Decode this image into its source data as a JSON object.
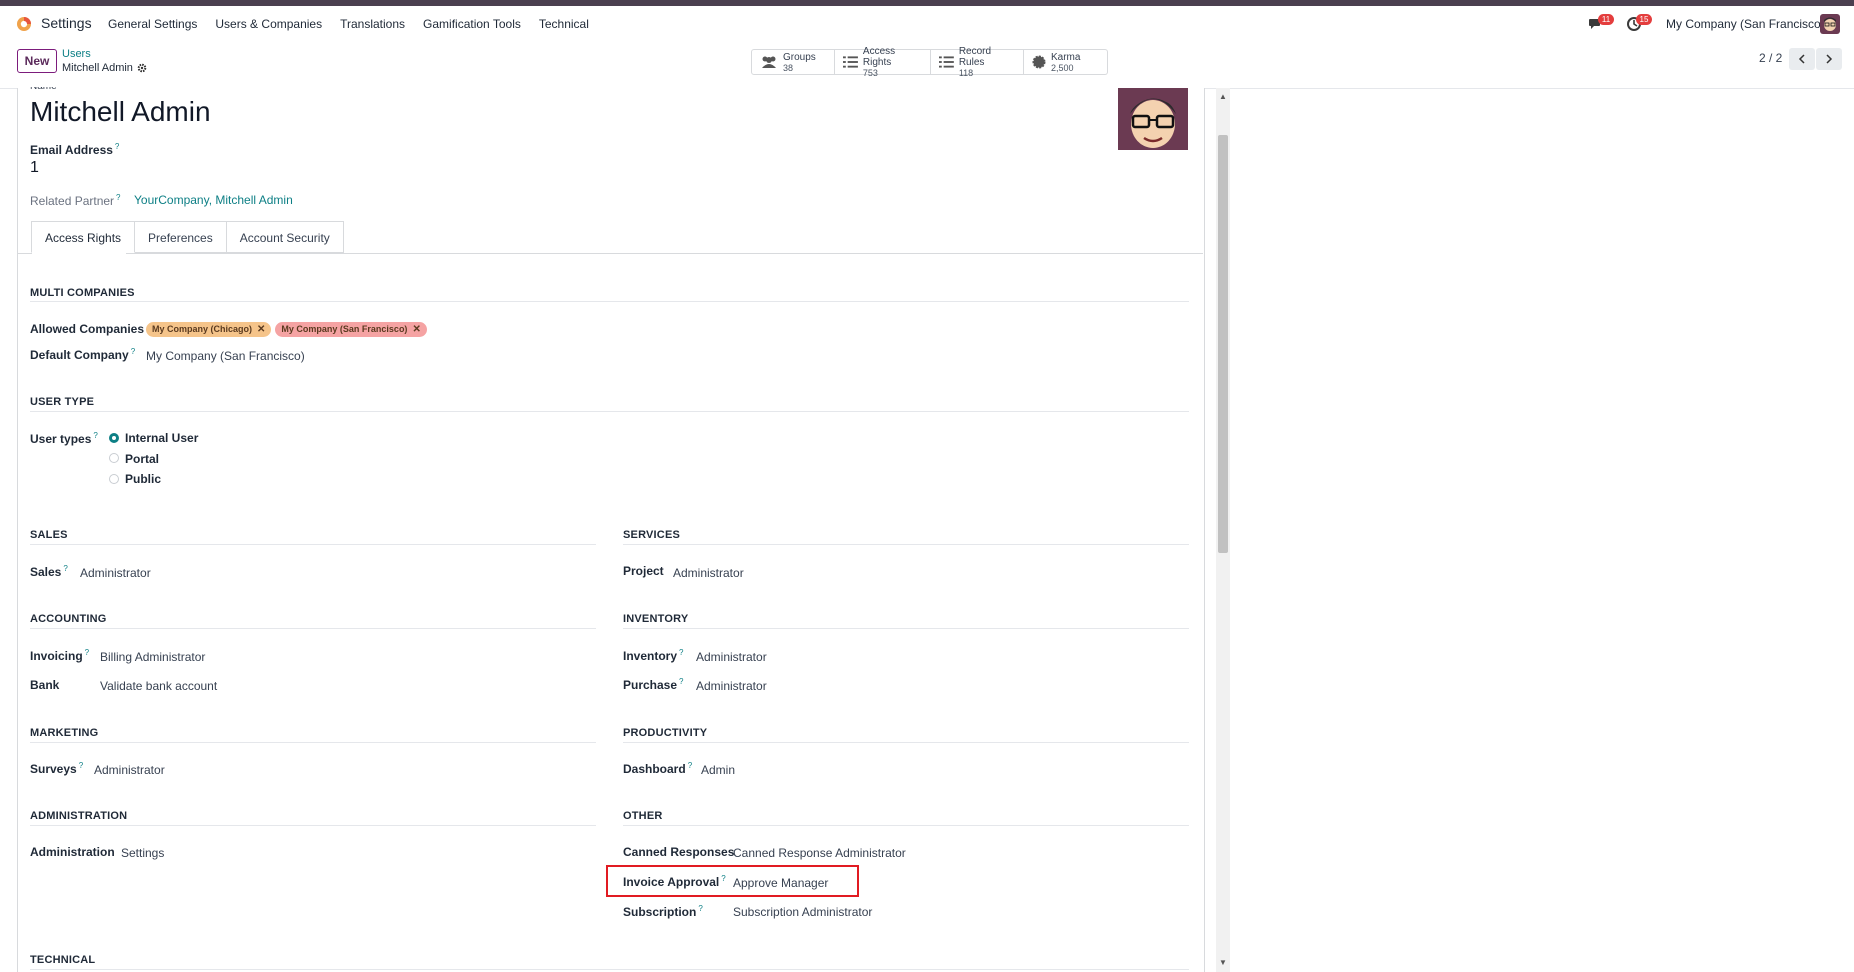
{
  "nav": {
    "app_name": "Settings",
    "menu": [
      "General Settings",
      "Users & Companies",
      "Translations",
      "Gamification Tools",
      "Technical"
    ],
    "messages_badge": "11",
    "activities_badge": "15",
    "company": "My Company (San Francisco)"
  },
  "control": {
    "new_label": "New",
    "breadcrumb_parent": "Users",
    "breadcrumb_current": "Mitchell Admin",
    "smart_buttons": [
      {
        "label": "Groups",
        "count": "38",
        "icon": "users-icon"
      },
      {
        "label": "Access Rights",
        "count": "753",
        "icon": "list-icon"
      },
      {
        "label": "Record Rules",
        "count": "118",
        "icon": "list-icon"
      },
      {
        "label": "Karma",
        "count": "2,500",
        "icon": "badge-icon"
      }
    ],
    "pager": "2 / 2"
  },
  "form": {
    "name_label": "Name",
    "name": "Mitchell Admin",
    "email_label": "Email Address",
    "email_value": "1",
    "related_partner_label": "Related Partner",
    "related_partner_value": "YourCompany, Mitchell Admin",
    "help": "?",
    "tabs": [
      "Access Rights",
      "Preferences",
      "Account Security"
    ],
    "multi_companies": {
      "title": "MULTI COMPANIES",
      "allowed_label": "Allowed Companies",
      "allowed": [
        {
          "name": "My Company (Chicago)",
          "color": "#f5c48a"
        },
        {
          "name": "My Company (San Francisco)",
          "color": "#f5a3a3"
        }
      ],
      "default_label": "Default Company",
      "default_value": "My Company (San Francisco)"
    },
    "user_type": {
      "title": "USER TYPE",
      "label": "User types",
      "options": [
        "Internal User",
        "Portal",
        "Public"
      ],
      "selected": "Internal User"
    },
    "sales": {
      "title": "SALES",
      "label": "Sales",
      "value": "Administrator"
    },
    "services": {
      "title": "SERVICES",
      "label": "Project",
      "value": "Administrator"
    },
    "accounting": {
      "title": "ACCOUNTING",
      "rows": [
        {
          "label": "Invoicing",
          "value": "Billing Administrator"
        },
        {
          "label": "Bank",
          "value": "Validate bank account"
        }
      ]
    },
    "inventory": {
      "title": "INVENTORY",
      "rows": [
        {
          "label": "Inventory",
          "value": "Administrator"
        },
        {
          "label": "Purchase",
          "value": "Administrator"
        }
      ]
    },
    "marketing": {
      "title": "MARKETING",
      "label": "Surveys",
      "value": "Administrator"
    },
    "productivity": {
      "title": "PRODUCTIVITY",
      "label": "Dashboard",
      "value": "Admin"
    },
    "administration": {
      "title": "ADMINISTRATION",
      "label": "Administration",
      "value": "Settings"
    },
    "other": {
      "title": "OTHER",
      "rows": [
        {
          "label": "Canned Responses",
          "value": "Canned Response Administrator"
        },
        {
          "label": "Invoice Approval",
          "value": "Approve Manager"
        },
        {
          "label": "Subscription",
          "value": "Subscription Administrator"
        }
      ]
    },
    "technical_title": "TECHNICAL"
  },
  "colors": {
    "accent": "#0d7f85",
    "brand": "#714b67",
    "highlight": "#e11b22"
  }
}
